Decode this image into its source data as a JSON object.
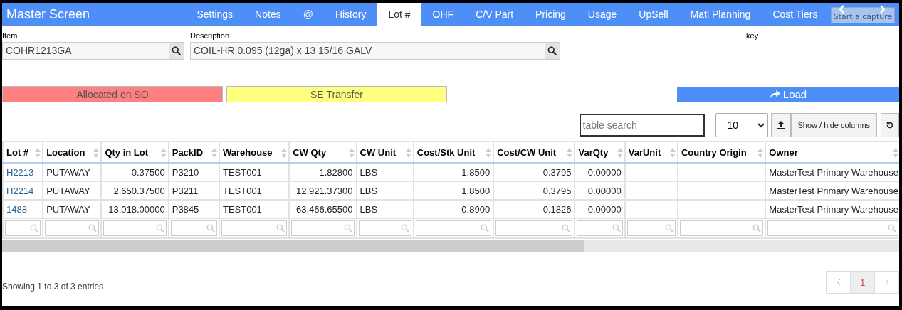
{
  "app_title": "Master Screen",
  "tabs": [
    {
      "label": "Settings",
      "selected": false
    },
    {
      "label": "Notes",
      "selected": false
    },
    {
      "label": "@",
      "selected": false
    },
    {
      "label": "History",
      "selected": false
    },
    {
      "label": "Lot #",
      "selected": true
    },
    {
      "label": "OHF",
      "selected": false
    },
    {
      "label": "C/V Part",
      "selected": false
    },
    {
      "label": "Pricing",
      "selected": false
    },
    {
      "label": "Usage",
      "selected": false
    },
    {
      "label": "UpSell",
      "selected": false
    },
    {
      "label": "Matl Planning",
      "selected": false
    },
    {
      "label": "Cost Tiers",
      "selected": false
    }
  ],
  "capture_overlay": {
    "label": "Start a capture"
  },
  "item": {
    "label": "Item",
    "value": "COHR1213GA"
  },
  "description": {
    "label": "Description",
    "value": "COIL-HR 0.095 (12ga) x 13 15/16 GALV"
  },
  "ikey": {
    "label": "Ikey"
  },
  "legend": [
    {
      "label": "Allocated on SO",
      "color": "#ff8080"
    },
    {
      "label": "SE Transfer",
      "color": "#ffff80"
    }
  ],
  "load_button": "Load",
  "table_search": {
    "placeholder": "table search"
  },
  "page_size": "10",
  "show_hide_button": "Show / hide columns",
  "table": {
    "columns": [
      {
        "label": "Lot #",
        "kind": "link"
      },
      {
        "label": "Location",
        "kind": "text"
      },
      {
        "label": "Qty in Lot",
        "kind": "number"
      },
      {
        "label": "PackID",
        "kind": "text"
      },
      {
        "label": "Warehouse",
        "kind": "text"
      },
      {
        "label": "CW Qty",
        "kind": "number"
      },
      {
        "label": "CW Unit",
        "kind": "text"
      },
      {
        "label": "Cost/Stk Unit",
        "kind": "number"
      },
      {
        "label": "Cost/CW Unit",
        "kind": "number"
      },
      {
        "label": "VarQty",
        "kind": "number"
      },
      {
        "label": "VarUnit",
        "kind": "text"
      },
      {
        "label": "Country Origin",
        "kind": "text"
      },
      {
        "label": "Owner",
        "kind": "text"
      }
    ],
    "rows": [
      [
        "H2213",
        "PUTAWAY",
        "0.37500",
        "P3210",
        "TEST001",
        "1.82800",
        "LBS",
        "1.8500",
        "0.3795",
        "0.00000",
        "",
        "",
        "MasterTest Primary Warehouse"
      ],
      [
        "H2214",
        "PUTAWAY",
        "2,650.37500",
        "P3211",
        "TEST001",
        "12,921.37300",
        "LBS",
        "1.8500",
        "0.3795",
        "0.00000",
        "",
        "",
        "MasterTest Primary Warehouse"
      ],
      [
        "1488",
        "PUTAWAY",
        "13,018.00000",
        "P3845",
        "TEST001",
        "63,466.65500",
        "LBS",
        "0.8900",
        "0.1826",
        "0.00000",
        "",
        "",
        "MasterTest Primary Warehouse"
      ]
    ]
  },
  "footer": "Showing 1 to 3 of 3 entries",
  "pagination": [
    {
      "label": "1",
      "selected": true
    }
  ]
}
